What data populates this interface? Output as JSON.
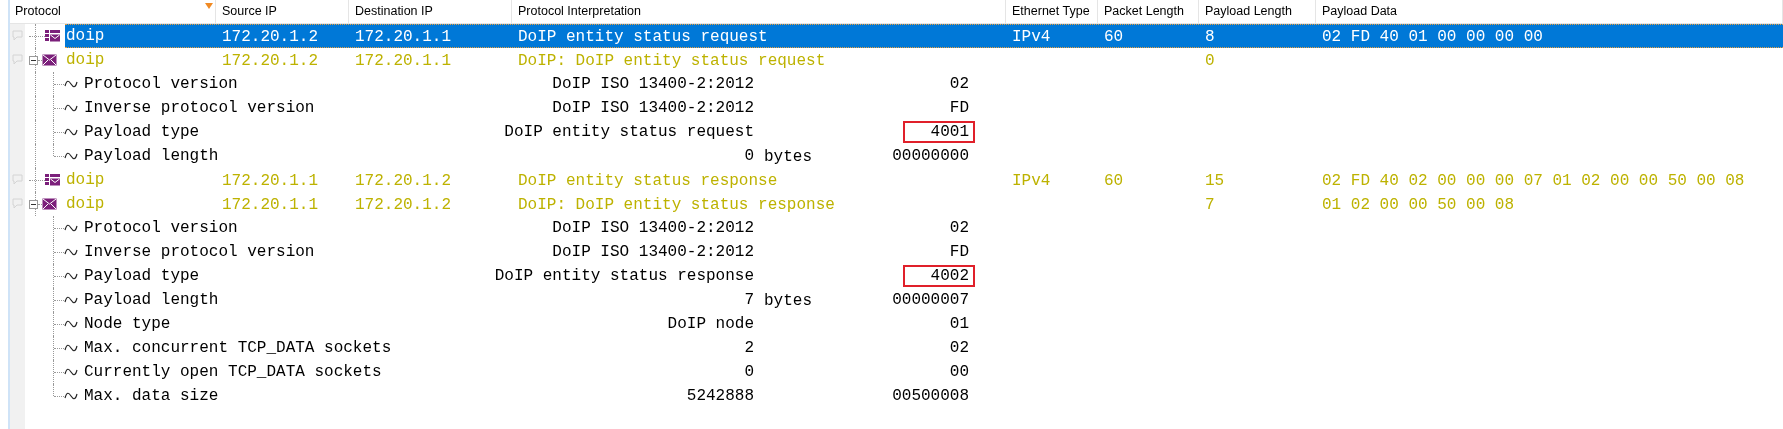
{
  "columns": [
    {
      "label": "Protocol",
      "sorted": true
    },
    {
      "label": "Source IP",
      "sorted": false
    },
    {
      "label": "Destination IP",
      "sorted": false
    },
    {
      "label": "Protocol Interpretation",
      "sorted": false
    },
    {
      "label": "Ethernet Type",
      "sorted": false
    },
    {
      "label": "Packet Length",
      "sorted": false
    },
    {
      "label": "Payload Length",
      "sorted": false
    },
    {
      "label": "Payload Data",
      "sorted": false
    }
  ],
  "rows": [
    {
      "kind": "frame",
      "selected": true,
      "protocol": "doip",
      "source_ip": "172.20.1.2",
      "destination_ip": "172.20.1.1",
      "interpretation": "DoIP entity status request",
      "ethernet_type": "IPv4",
      "packet_length": "60",
      "payload_length": "8",
      "payload_data": "02 FD 40 01 00 00 00 00"
    },
    {
      "kind": "message",
      "selected": false,
      "expanded": true,
      "protocol": "doip",
      "source_ip": "172.20.1.2",
      "destination_ip": "172.20.1.1",
      "interpretation": "DoIP: DoIP entity status request",
      "payload_length": "0",
      "children": [
        {
          "name": "Protocol version",
          "value": "DoIP ISO 13400-2:2012",
          "hex": "02",
          "highlighted": false
        },
        {
          "name": "Inverse protocol version",
          "value": "DoIP ISO 13400-2:2012",
          "hex": "FD",
          "highlighted": false
        },
        {
          "name": "Payload type",
          "value": "DoIP entity status request",
          "hex": "4001",
          "highlighted": true
        },
        {
          "name": "Payload length",
          "value": "0",
          "unit": "bytes",
          "hex": "00000000",
          "highlighted": false
        }
      ]
    },
    {
      "kind": "frame",
      "selected": false,
      "protocol": "doip",
      "source_ip": "172.20.1.1",
      "destination_ip": "172.20.1.2",
      "interpretation": "DoIP entity status response",
      "ethernet_type": "IPv4",
      "packet_length": "60",
      "payload_length": "15",
      "payload_data": "02 FD 40 02 00 00 00 07 01 02 00 00 50 00 08"
    },
    {
      "kind": "message",
      "selected": false,
      "expanded": true,
      "protocol": "doip",
      "source_ip": "172.20.1.1",
      "destination_ip": "172.20.1.2",
      "interpretation": "DoIP: DoIP entity status response",
      "payload_length": "7",
      "payload_data": "01 02 00 00 50 00 08",
      "children": [
        {
          "name": "Protocol version",
          "value": "DoIP ISO 13400-2:2012",
          "hex": "02",
          "highlighted": false
        },
        {
          "name": "Inverse protocol version",
          "value": "DoIP ISO 13400-2:2012",
          "hex": "FD",
          "highlighted": false
        },
        {
          "name": "Payload type",
          "value": "DoIP entity status response",
          "hex": "4002",
          "highlighted": true
        },
        {
          "name": "Payload length",
          "value": "7",
          "unit": "bytes",
          "hex": "00000007",
          "highlighted": false
        },
        {
          "name": "Node type",
          "value": "DoIP node",
          "hex": "01",
          "highlighted": false
        },
        {
          "name": "Max. concurrent TCP_DATA sockets",
          "value": "2",
          "hex": "02",
          "highlighted": false
        },
        {
          "name": "Currently open TCP_DATA sockets",
          "value": "0",
          "hex": "00",
          "highlighted": false
        },
        {
          "name": "Max. data size",
          "value": "5242888",
          "hex": "00500008",
          "highlighted": false
        }
      ]
    }
  ]
}
